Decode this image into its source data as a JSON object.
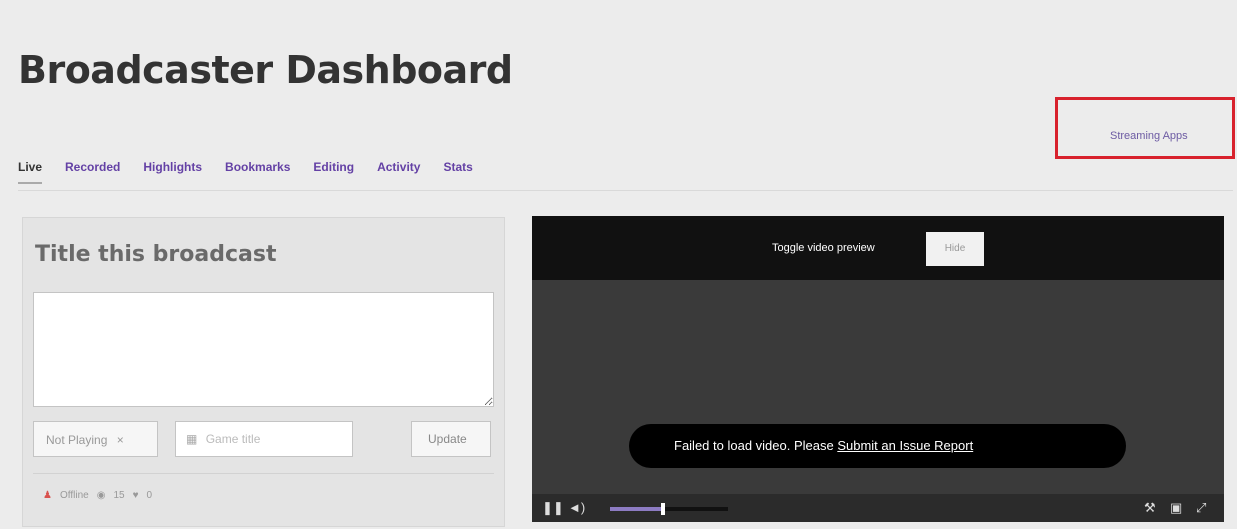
{
  "page_title": "Broadcaster Dashboard",
  "streaming_apps_label": "Streaming Apps",
  "tabs": [
    {
      "label": "Live",
      "active": true
    },
    {
      "label": "Recorded",
      "active": false
    },
    {
      "label": "Highlights",
      "active": false
    },
    {
      "label": "Bookmarks",
      "active": false
    },
    {
      "label": "Editing",
      "active": false
    },
    {
      "label": "Activity",
      "active": false
    },
    {
      "label": "Stats",
      "active": false
    }
  ],
  "broadcast": {
    "panel_title": "Title this broadcast",
    "title_value": "",
    "game_select_value": "Not Playing",
    "game_select_icon": "close-icon",
    "game_input_placeholder": "Game title",
    "update_label": "Update"
  },
  "status": {
    "offline_label": "Offline",
    "viewers_count": "15",
    "followers_count": "0"
  },
  "video": {
    "toggle_label": "Toggle video preview",
    "hide_label": "Hide",
    "error_text": "Failed to load video. Please ",
    "error_link": "Submit an Issue Report",
    "volume_level": 0.45
  },
  "colors": {
    "accent": "#6441a5",
    "highlight_box": "#d8222d"
  }
}
